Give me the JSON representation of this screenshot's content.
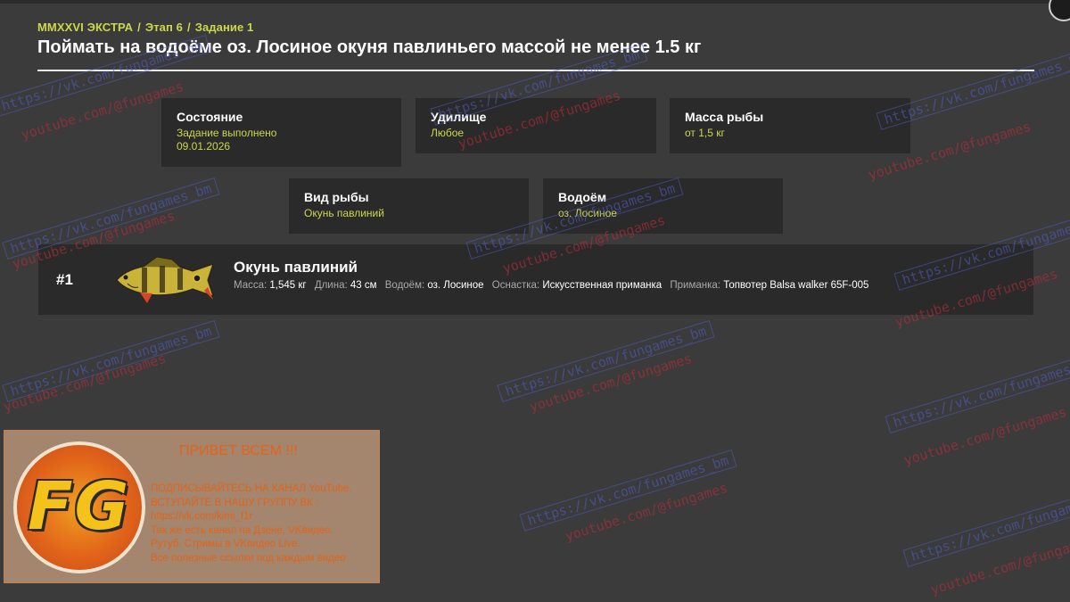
{
  "header": {
    "breadcrumb": [
      "MMXXVI ЭКСТРА",
      "Этап 6",
      "Задание 1"
    ],
    "breadcrumb_separator": "/",
    "title": "Поймать на водоёме оз. Лосиное окуня павлиньего массой не менее 1.5 кг"
  },
  "cards": {
    "status": {
      "label": "Состояние",
      "value": "Задание выполнено",
      "date": "09.01.2026"
    },
    "rod": {
      "label": "Удилище",
      "value": "Любое"
    },
    "weight": {
      "label": "Масса рыбы",
      "value": "от 1,5 кг"
    },
    "species": {
      "label": "Вид рыбы",
      "value": "Окунь павлиний"
    },
    "water": {
      "label": "Водоём",
      "value": "оз. Лосиное"
    }
  },
  "result": {
    "rank": "#1",
    "fish_name": "Окунь павлиний",
    "stats": [
      {
        "label": "Масса:",
        "value": "1,545 кг"
      },
      {
        "label": "Длина:",
        "value": "43 см"
      },
      {
        "label": "Водоём:",
        "value": "оз. Лосиное"
      },
      {
        "label": "Оснастка:",
        "value": "Искусственная приманка"
      },
      {
        "label": "Приманка:",
        "value": "Топвотер Balsa walker 65F-005"
      }
    ]
  },
  "watermarks": {
    "vk": "https://vk.com/fungames_bm",
    "youtube": "youtube.com/@fungames"
  },
  "promo": {
    "logo_text": "FG",
    "heading": "ПРИВЕТ ВСЕМ !!!",
    "lines": [
      "ПОДПИСЫВАЙТЕСЬ НА КАНАЛ YouTube.",
      "ВСТУПАЙТЕ В НАШУ ГРУППУ ВК :",
      "https://vk.com/kimi_f1r",
      "Так же есть канал на Дзене, VKвидео.",
      "Рутуб. Стримы в VKвидео Live.",
      "Все полезные ссылки под каждым видео"
    ]
  },
  "colors": {
    "background": "#3b3b3c",
    "card": "#2a2a2a",
    "accent": "#cbd84a",
    "promo_text": "#e2641a"
  }
}
